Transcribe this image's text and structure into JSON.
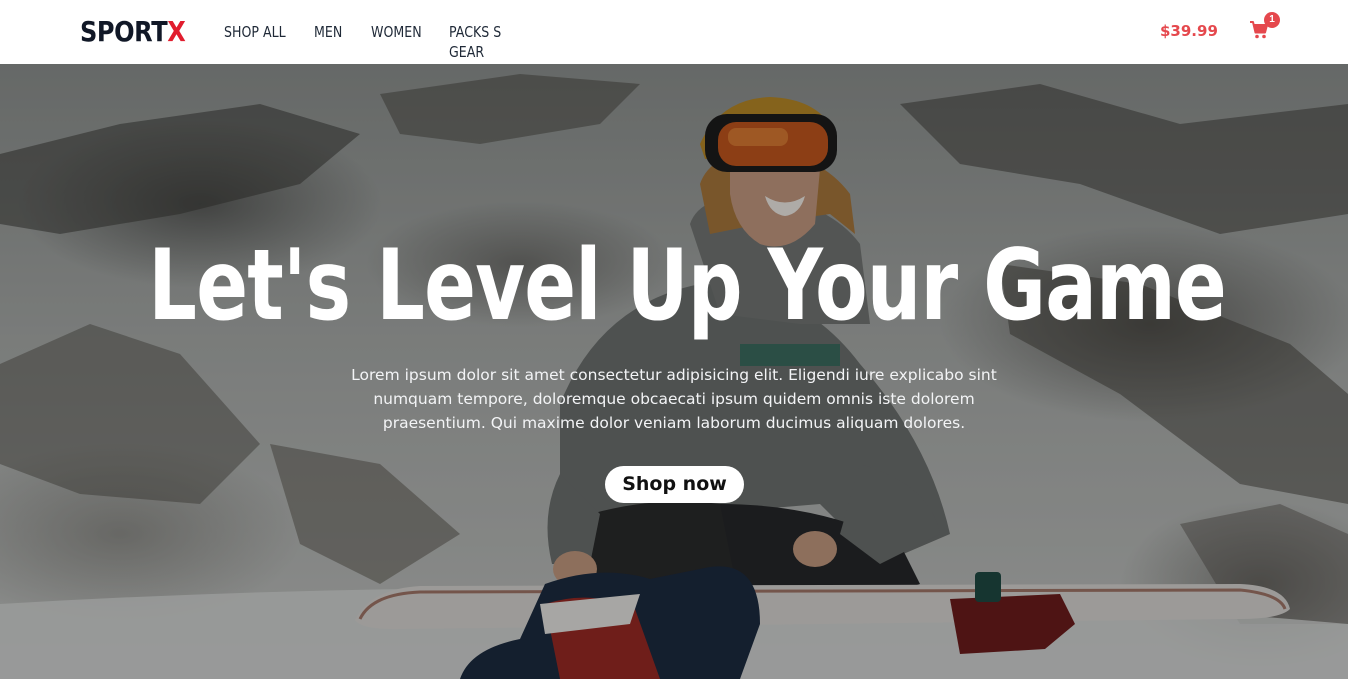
{
  "header": {
    "logo": {
      "main": "SPORT",
      "accent": "X"
    },
    "nav": [
      "SHOP ALL",
      "MEN",
      "WOMEN",
      "PACKS S GEAR"
    ],
    "cart_total": "$39.99",
    "cart_count": "1",
    "cart_icon": "shopping-cart-icon"
  },
  "hero": {
    "title": "Let's Level Up Your Game",
    "text": "Lorem ipsum dolor sit amet consectetur adipisicing elit. Eligendi iure explicabo sint numquam tempore, doloremque obcaecati ipsum quidem omnis iste dolorem praesentium. Qui maxime dolor veniam laborum ducimus aliquam dolores.",
    "cta_label": "Shop now",
    "background": "snowboarder sitting on snowy mountain slope"
  },
  "colors": {
    "accent": "#e11d2e",
    "price": "#e5484d",
    "logo_dark": "#111827",
    "hero_text": "#ffffff"
  }
}
